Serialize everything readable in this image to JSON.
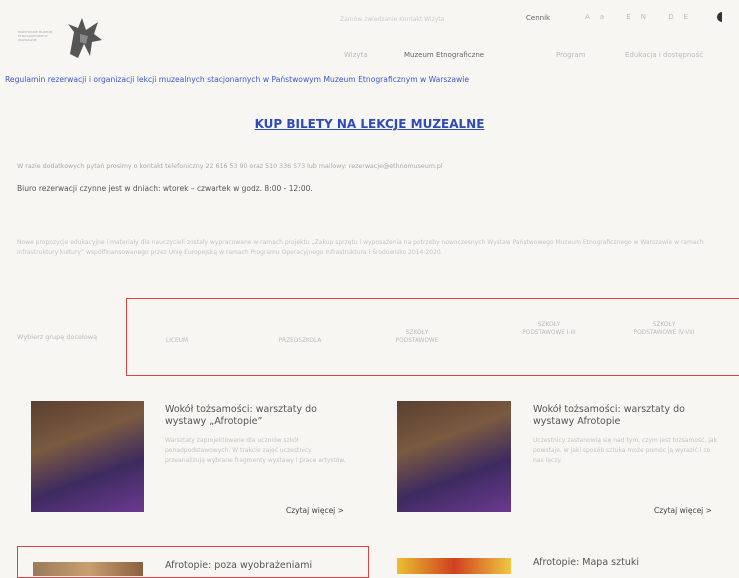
{
  "header": {
    "logo_text": "PAŃSTWOWE MUZEUM ETNOGRAFICZNE W WARSZAWIE",
    "top_links": "Zamów zwiedzanie     Kontakt     Wizyta",
    "cennik": "Cennik",
    "util_icons": "Aa EN DE",
    "nav": [
      "Wizyta",
      "Muzeum Etnograficzne",
      "Program",
      "Edukacja i dostępność"
    ]
  },
  "regulamin_link": "Regulamin rezerwacji i organizacji lekcji muzealnych stacjonarnych w Państwowym Muzeum Etnograficznym w Warszawie",
  "buy_tickets": "KUP BILETY NA LEKCJE MUZEALNE",
  "contact": "W razie dodatkowych pytań prosimy o kontakt telefoniczny 22 616 53 90 oraz 510 336 573 lub mailowy: rezerwacje@ethnomuseum.pl",
  "hours": "Biuro rezerwacji czynne jest w dniach: wtorek – czwartek w godz. 8:00 - 12:00.",
  "info": "Nowe propozycje edukacyjne i materiały dla nauczycieli zostały wypracowane w ramach projektu „Zakup sprzętu i wyposażenia na potrzeby nowoczesnych Wystaw Państwowego Muzeum Etnograficznego w Warszawie w ramach infrastruktury kultury” współfinansowanego przez Unię Europejską w ramach Programu Operacyjnego Infrastruktura i Środowisko 2014-2020.",
  "filter": {
    "label": "Wybierz grupę docelową",
    "options": [
      "LICEUM",
      "PRZEDSZKOLA",
      "SZKOŁY PODSTAWOWE",
      "SZKOŁY PODSTAWOWE I-III",
      "SZKOŁY PODSTAWOWE IV-VIII"
    ]
  },
  "cards": [
    {
      "title": "Wokół tożsamości: warsztaty do wystawy „Afrotopie”",
      "desc": "Warsztaty zaprojektowane dla uczniów szkół ponadpodstawowych. W trakcie zajęć uczestnicy przeanalizują wybrane fragmenty wystawy i prace artystów.",
      "more": "Czytaj więcej >"
    },
    {
      "title": "Wokół tożsamości: warsztaty do wystawy Afrotopie",
      "desc": "Uczestnicy zastanowią się nad tym, czym jest tożsamość, jak powstaje, w jaki sposób sztuka może pomóc ją wyrazić i co nas łączy.",
      "more": "Czytaj więcej >"
    },
    {
      "title": "Afrotopie: poza wyobrażeniami",
      "desc": "",
      "more": ""
    },
    {
      "title": "Afrotopie: Mapa sztuki",
      "desc": "",
      "more": ""
    }
  ]
}
